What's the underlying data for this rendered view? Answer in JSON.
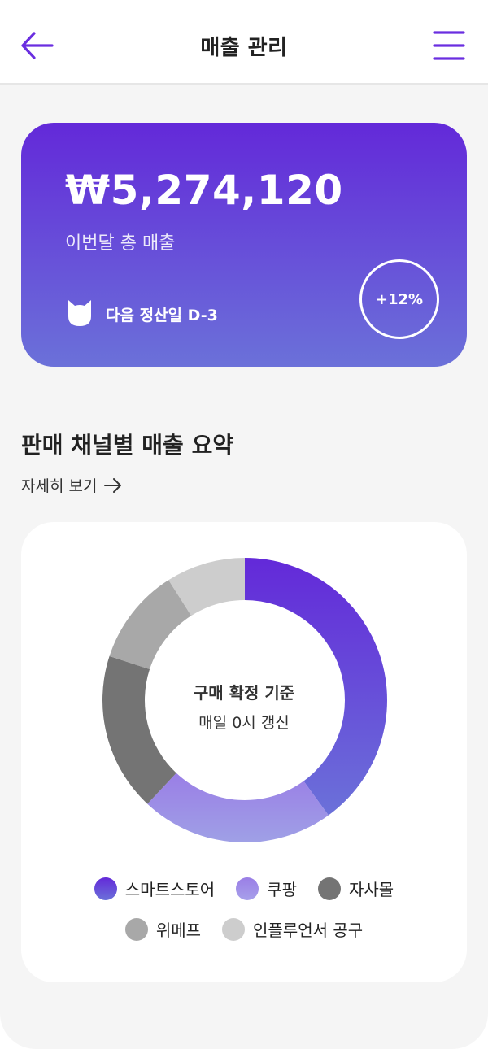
{
  "header": {
    "title": "매출 관리"
  },
  "summary_card": {
    "amount": "₩5,274,120",
    "amount_label": "이번달 총 매출",
    "settlement_text": "다음 정산일 D-3",
    "growth": "+12%"
  },
  "section": {
    "title": "판매 채널별 매출 요약",
    "detail_link": "자세히 보기"
  },
  "chart_center": {
    "title": "구매 확정 기준",
    "subtitle": "매일 0시 갱신"
  },
  "chart_data": {
    "type": "pie",
    "categories": [
      "스마트스토어",
      "쿠팡",
      "자사몰",
      "위메프",
      "인플루언서 공구"
    ],
    "values": [
      40,
      22,
      18,
      11,
      9
    ],
    "colors": [
      "#6329d9",
      "#9a7ee6",
      "#747474",
      "#a8a8a8",
      "#cdcdcd"
    ]
  },
  "legend": {
    "items": [
      {
        "label": "스마트스토어",
        "color": "#6329d9"
      },
      {
        "label": "쿠팡",
        "color": "#9a7ee6"
      },
      {
        "label": "자사몰",
        "color": "#747474"
      },
      {
        "label": "위메프",
        "color": "#a8a8a8"
      },
      {
        "label": "인플루언서 공구",
        "color": "#cdcdcd"
      }
    ]
  },
  "colors": {
    "accent": "#6a2ee0",
    "card_top": "#6329d9",
    "card_bottom": "#6b71d9"
  },
  "icons": {
    "back": "arrow-left-icon",
    "menu": "hamburger-menu-icon",
    "cat": "cat-icon",
    "link_arrow": "arrow-right-icon"
  }
}
